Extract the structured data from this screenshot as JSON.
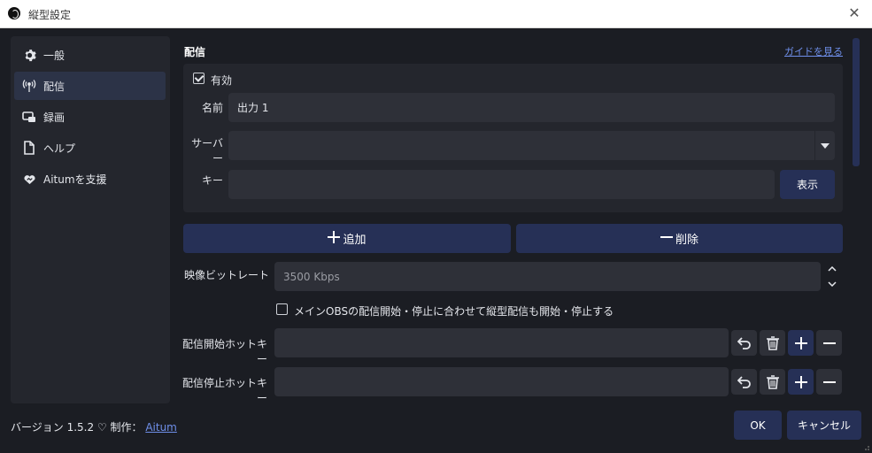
{
  "window": {
    "title": "縦型設定",
    "close_icon": "close-icon"
  },
  "sidebar": {
    "items": [
      {
        "label": "一般",
        "icon": "gear-icon",
        "active": false
      },
      {
        "label": "配信",
        "icon": "antenna-icon",
        "active": true
      },
      {
        "label": "録画",
        "icon": "camera-icon",
        "active": false
      },
      {
        "label": "ヘルプ",
        "icon": "document-icon",
        "active": false
      },
      {
        "label": "Aitumを支援",
        "icon": "heart-icon",
        "active": false
      }
    ]
  },
  "stream": {
    "section_title": "配信",
    "guide_link": "ガイドを見る",
    "enabled_label": "有効",
    "enabled": true,
    "name_label": "名前",
    "name_value": "出力 1",
    "server_label": "サーバー",
    "server_value": "",
    "key_label": "キー",
    "key_value": "",
    "show_button": "表示",
    "add_button": "追加",
    "remove_button": "削除",
    "bitrate_label": "映像ビットレート",
    "bitrate_value": "3500 Kbps",
    "sync_label": "メインOBSの配信開始・停止に合わせて縦型配信も開始・停止する",
    "sync_checked": false,
    "start_hotkey_label": "配信開始ホットキー",
    "start_hotkey_value": "",
    "stop_hotkey_label": "配信停止ホットキー",
    "stop_hotkey_value": ""
  },
  "footer": {
    "version_text": "バージョン 1.5.2 ♡ 制作：",
    "author_link": "Aitum",
    "ok_button": "OK",
    "cancel_button": "キャンセル"
  },
  "colors": {
    "background": "#1b1d23",
    "panel": "#24262d",
    "field": "#2e3038",
    "accent": "#263056",
    "link": "#6f8fea"
  }
}
